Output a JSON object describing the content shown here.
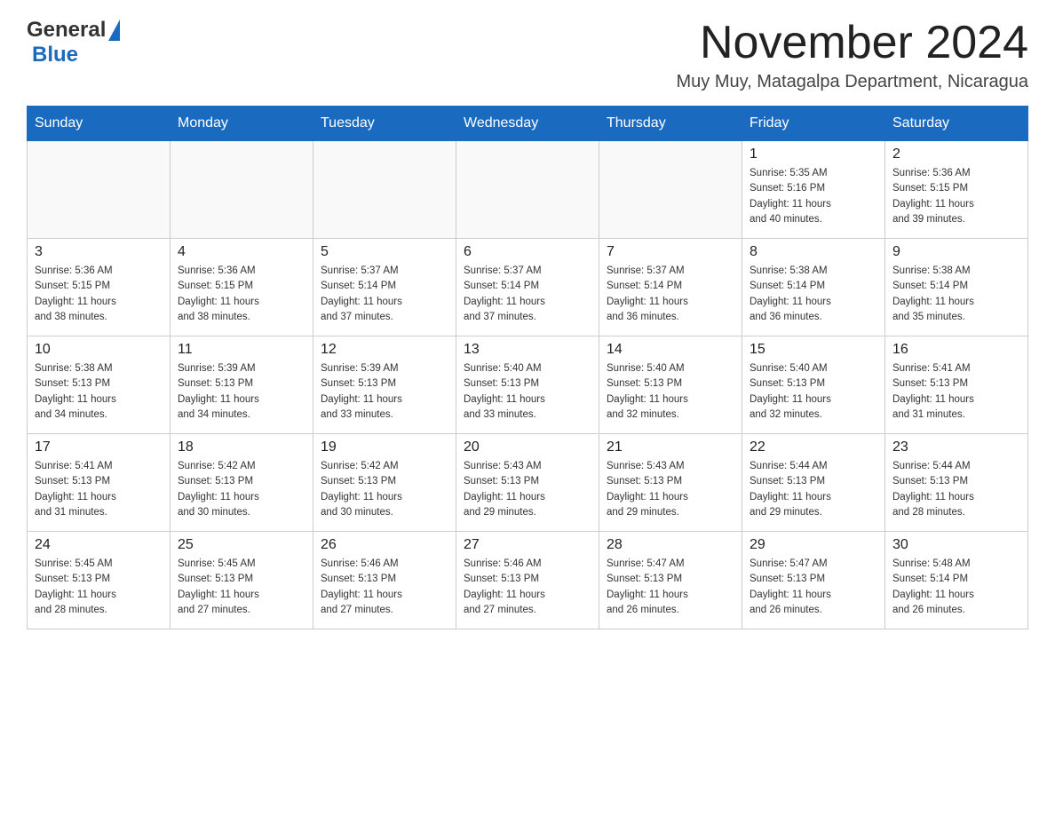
{
  "header": {
    "logo": {
      "general": "General",
      "blue": "Blue"
    },
    "month_title": "November 2024",
    "location": "Muy Muy, Matagalpa Department, Nicaragua"
  },
  "calendar": {
    "days_of_week": [
      "Sunday",
      "Monday",
      "Tuesday",
      "Wednesday",
      "Thursday",
      "Friday",
      "Saturday"
    ],
    "weeks": [
      [
        {
          "day": "",
          "info": ""
        },
        {
          "day": "",
          "info": ""
        },
        {
          "day": "",
          "info": ""
        },
        {
          "day": "",
          "info": ""
        },
        {
          "day": "",
          "info": ""
        },
        {
          "day": "1",
          "info": "Sunrise: 5:35 AM\nSunset: 5:16 PM\nDaylight: 11 hours\nand 40 minutes."
        },
        {
          "day": "2",
          "info": "Sunrise: 5:36 AM\nSunset: 5:15 PM\nDaylight: 11 hours\nand 39 minutes."
        }
      ],
      [
        {
          "day": "3",
          "info": "Sunrise: 5:36 AM\nSunset: 5:15 PM\nDaylight: 11 hours\nand 38 minutes."
        },
        {
          "day": "4",
          "info": "Sunrise: 5:36 AM\nSunset: 5:15 PM\nDaylight: 11 hours\nand 38 minutes."
        },
        {
          "day": "5",
          "info": "Sunrise: 5:37 AM\nSunset: 5:14 PM\nDaylight: 11 hours\nand 37 minutes."
        },
        {
          "day": "6",
          "info": "Sunrise: 5:37 AM\nSunset: 5:14 PM\nDaylight: 11 hours\nand 37 minutes."
        },
        {
          "day": "7",
          "info": "Sunrise: 5:37 AM\nSunset: 5:14 PM\nDaylight: 11 hours\nand 36 minutes."
        },
        {
          "day": "8",
          "info": "Sunrise: 5:38 AM\nSunset: 5:14 PM\nDaylight: 11 hours\nand 36 minutes."
        },
        {
          "day": "9",
          "info": "Sunrise: 5:38 AM\nSunset: 5:14 PM\nDaylight: 11 hours\nand 35 minutes."
        }
      ],
      [
        {
          "day": "10",
          "info": "Sunrise: 5:38 AM\nSunset: 5:13 PM\nDaylight: 11 hours\nand 34 minutes."
        },
        {
          "day": "11",
          "info": "Sunrise: 5:39 AM\nSunset: 5:13 PM\nDaylight: 11 hours\nand 34 minutes."
        },
        {
          "day": "12",
          "info": "Sunrise: 5:39 AM\nSunset: 5:13 PM\nDaylight: 11 hours\nand 33 minutes."
        },
        {
          "day": "13",
          "info": "Sunrise: 5:40 AM\nSunset: 5:13 PM\nDaylight: 11 hours\nand 33 minutes."
        },
        {
          "day": "14",
          "info": "Sunrise: 5:40 AM\nSunset: 5:13 PM\nDaylight: 11 hours\nand 32 minutes."
        },
        {
          "day": "15",
          "info": "Sunrise: 5:40 AM\nSunset: 5:13 PM\nDaylight: 11 hours\nand 32 minutes."
        },
        {
          "day": "16",
          "info": "Sunrise: 5:41 AM\nSunset: 5:13 PM\nDaylight: 11 hours\nand 31 minutes."
        }
      ],
      [
        {
          "day": "17",
          "info": "Sunrise: 5:41 AM\nSunset: 5:13 PM\nDaylight: 11 hours\nand 31 minutes."
        },
        {
          "day": "18",
          "info": "Sunrise: 5:42 AM\nSunset: 5:13 PM\nDaylight: 11 hours\nand 30 minutes."
        },
        {
          "day": "19",
          "info": "Sunrise: 5:42 AM\nSunset: 5:13 PM\nDaylight: 11 hours\nand 30 minutes."
        },
        {
          "day": "20",
          "info": "Sunrise: 5:43 AM\nSunset: 5:13 PM\nDaylight: 11 hours\nand 29 minutes."
        },
        {
          "day": "21",
          "info": "Sunrise: 5:43 AM\nSunset: 5:13 PM\nDaylight: 11 hours\nand 29 minutes."
        },
        {
          "day": "22",
          "info": "Sunrise: 5:44 AM\nSunset: 5:13 PM\nDaylight: 11 hours\nand 29 minutes."
        },
        {
          "day": "23",
          "info": "Sunrise: 5:44 AM\nSunset: 5:13 PM\nDaylight: 11 hours\nand 28 minutes."
        }
      ],
      [
        {
          "day": "24",
          "info": "Sunrise: 5:45 AM\nSunset: 5:13 PM\nDaylight: 11 hours\nand 28 minutes."
        },
        {
          "day": "25",
          "info": "Sunrise: 5:45 AM\nSunset: 5:13 PM\nDaylight: 11 hours\nand 27 minutes."
        },
        {
          "day": "26",
          "info": "Sunrise: 5:46 AM\nSunset: 5:13 PM\nDaylight: 11 hours\nand 27 minutes."
        },
        {
          "day": "27",
          "info": "Sunrise: 5:46 AM\nSunset: 5:13 PM\nDaylight: 11 hours\nand 27 minutes."
        },
        {
          "day": "28",
          "info": "Sunrise: 5:47 AM\nSunset: 5:13 PM\nDaylight: 11 hours\nand 26 minutes."
        },
        {
          "day": "29",
          "info": "Sunrise: 5:47 AM\nSunset: 5:13 PM\nDaylight: 11 hours\nand 26 minutes."
        },
        {
          "day": "30",
          "info": "Sunrise: 5:48 AM\nSunset: 5:14 PM\nDaylight: 11 hours\nand 26 minutes."
        }
      ]
    ]
  }
}
